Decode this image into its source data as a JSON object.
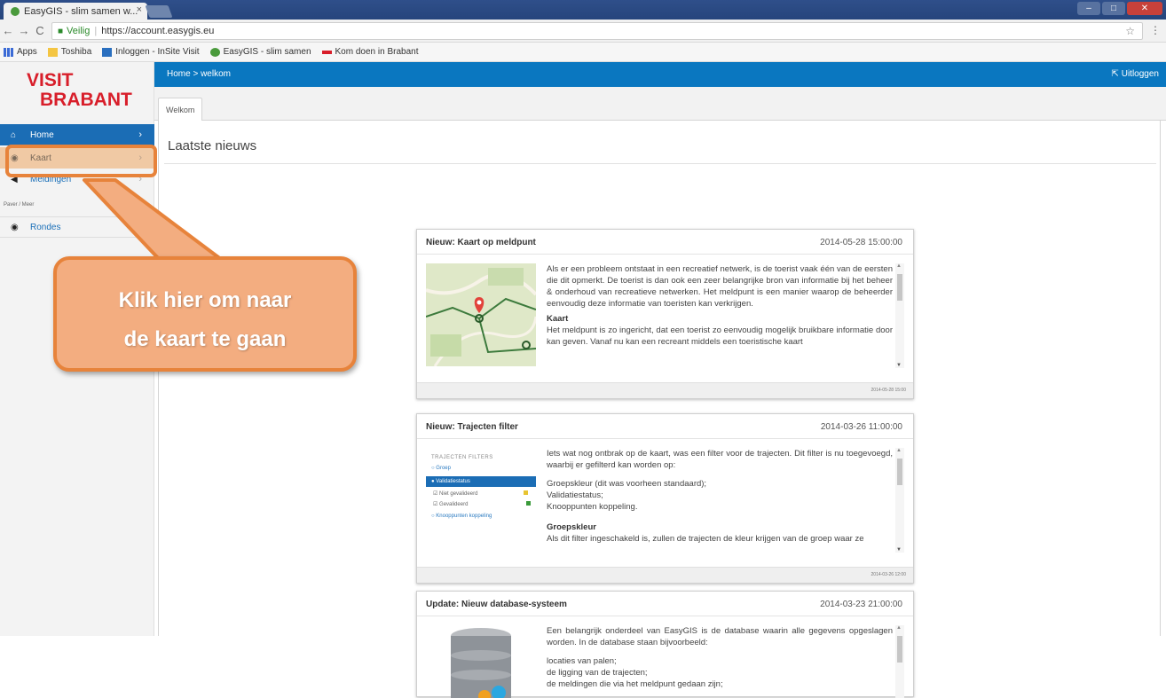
{
  "browser": {
    "tab_title": "EasyGIS - slim samen w...",
    "tab_close": "×",
    "secure_label": "Veilig",
    "url": "https://account.easygis.eu",
    "bookmarks": [
      {
        "label": "Apps"
      },
      {
        "label": "Toshiba"
      },
      {
        "label": "Inloggen - InSite Visit"
      },
      {
        "label": "EasyGIS - slim samen"
      },
      {
        "label": "Kom doen in Brabant"
      }
    ]
  },
  "logo": {
    "line1": "VISIT",
    "line2": "BRABANT"
  },
  "sidebar": {
    "items": [
      {
        "label": "Home"
      },
      {
        "label": "Kaart"
      },
      {
        "label": "Meldingen"
      },
      {
        "label": "Rondes"
      }
    ],
    "section_label": "Paver / Meer"
  },
  "topbar": {
    "breadcrumb": "Home > welkom",
    "logout": "Uitloggen"
  },
  "tabs": [
    {
      "label": "Welkom"
    }
  ],
  "news": {
    "heading": "Laatste nieuws",
    "cards": [
      {
        "title": "Nieuw: Kaart op meldpunt",
        "date": "2014-05-28 15:00:00",
        "p1": "Als er een probleem ontstaat in een recreatief netwerk, is de toerist vaak één van de eersten die dit opmerkt. De toerist is dan ook een zeer belangrijke bron van informatie bij het beheer & onderhoud van recreatieve netwerken. Het meldpunt is een manier waarop de beheerder eenvoudig deze informatie van toeristen kan verkrijgen.",
        "subheading": "Kaart",
        "p2": "Het meldpunt is zo ingericht, dat een toerist zo eenvoudig mogelijk bruikbare informatie door kan geven. Vanaf nu kan een recreant middels een toeristische kaart",
        "footer": "2014-05-28 15:00"
      },
      {
        "title": "Nieuw: Trajecten filter",
        "date": "2014-03-26 11:00:00",
        "p1": "Iets wat nog ontbrak op de kaart, was een filter voor de trajecten. Dit filter is nu toegevoegd, waarbij er gefilterd kan worden op:",
        "list": [
          "Groepskleur (dit was voorheen standaard);",
          "Validatiestatus;",
          "Knooppunten koppeling."
        ],
        "subheading": "Groepskleur",
        "p2": "Als dit filter ingeschakeld is, zullen de trajecten de kleur krijgen van de groep waar ze",
        "footer": "2014-03-26 12:00",
        "filter_panel": {
          "title": "TRAJECTEN FILTERS",
          "items": [
            "Groep",
            "Validatiestatus",
            "Niet gevalideerd",
            "Gevalideerd",
            "Knooppunten koppeling"
          ]
        }
      },
      {
        "title": "Update: Nieuw database-systeem",
        "date": "2014-03-23 21:00:00",
        "p1": "Een belangrijk onderdeel van EasyGIS is de database waarin alle gegevens opgeslagen worden. In de database staan bijvoorbeeld:",
        "list": [
          "locaties van palen;",
          "de ligging van de trajecten;",
          "de meldingen die via het meldpunt gedaan zijn;"
        ]
      }
    ]
  },
  "callout": {
    "line1": "Klik hier om naar",
    "line2": "de kaart te gaan"
  },
  "colors": {
    "topbar": "#0a77c0",
    "home_active": "#1b6db5",
    "logo_red": "#d81e2a",
    "callout_fill": "#f3ad80",
    "callout_border": "#e7833b"
  }
}
